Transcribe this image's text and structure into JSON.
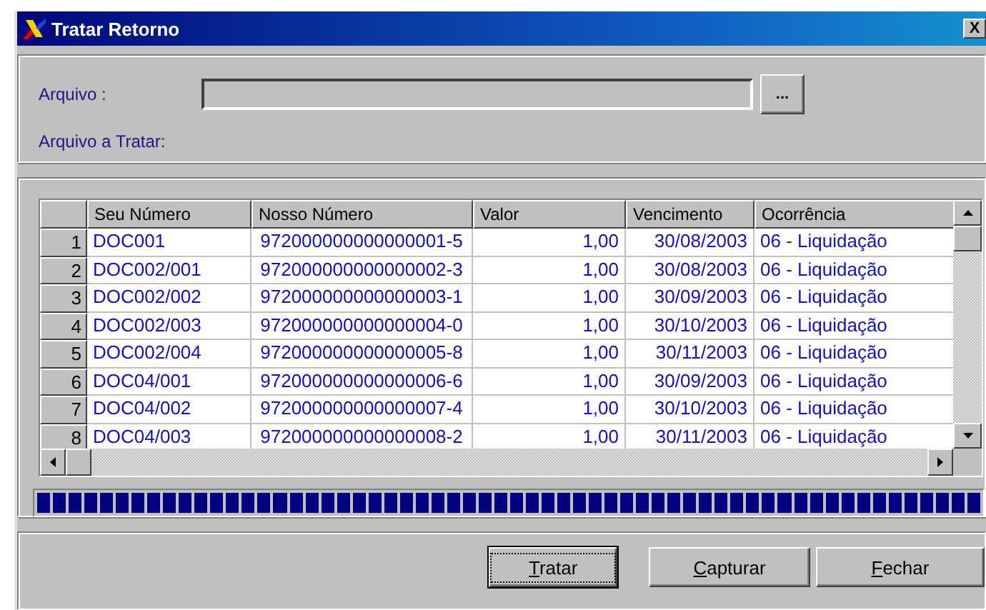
{
  "window": {
    "title": "Tratar Retorno",
    "close": "X"
  },
  "file": {
    "label": "Arquivo :",
    "browse": "...",
    "to_process_label": "Arquivo a Tratar:"
  },
  "table": {
    "columns": [
      "Seu Número",
      "Nosso Número",
      "Valor",
      "Vencimento",
      "Ocorrência"
    ],
    "rows": [
      {
        "index": "1",
        "cells": [
          "DOC001",
          "972000000000000001-5",
          "1,00",
          "30/08/2003",
          "06 - Liquidação"
        ]
      },
      {
        "index": "2",
        "cells": [
          "DOC002/001",
          "972000000000000002-3",
          "1,00",
          "30/08/2003",
          "06 - Liquidação"
        ]
      },
      {
        "index": "3",
        "cells": [
          "DOC002/002",
          "972000000000000003-1",
          "1,00",
          "30/09/2003",
          "06 - Liquidação"
        ]
      },
      {
        "index": "4",
        "cells": [
          "DOC002/003",
          "972000000000000004-0",
          "1,00",
          "30/10/2003",
          "06 - Liquidação"
        ]
      },
      {
        "index": "5",
        "cells": [
          "DOC002/004",
          "972000000000000005-8",
          "1,00",
          "30/11/2003",
          "06 - Liquidação"
        ]
      },
      {
        "index": "6",
        "cells": [
          "DOC04/001",
          "972000000000000006-6",
          "1,00",
          "30/09/2003",
          "06 - Liquidação"
        ]
      },
      {
        "index": "7",
        "cells": [
          "DOC04/002",
          "972000000000000007-4",
          "1,00",
          "30/10/2003",
          "06 - Liquidação"
        ]
      },
      {
        "index": "8",
        "cells": [
          "DOC04/003",
          "972000000000000008-2",
          "1,00",
          "30/11/2003",
          "06 - Liquidação"
        ]
      }
    ]
  },
  "progress": {
    "level": 1
  },
  "buttons": [
    {
      "label": "Tratar",
      "selected": true
    },
    {
      "label": "Capturar",
      "selected": false
    },
    {
      "label": "Fechar",
      "selected": false
    }
  ]
}
